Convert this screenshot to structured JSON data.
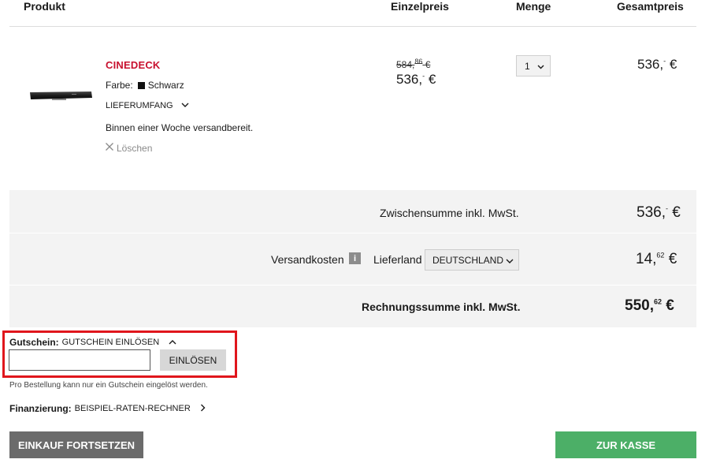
{
  "header": {
    "product": "Produkt",
    "unit_price": "Einzelpreis",
    "quantity": "Menge",
    "total_price": "Gesamtpreis"
  },
  "item": {
    "brand": "CINEDECK",
    "color_label": "Farbe:",
    "color_value": "Schwarz",
    "scope": "LIEFERUMFANG",
    "availability": "Binnen einer Woche versandbereit.",
    "delete": "Löschen",
    "old_price_main": "584,",
    "old_price_sup": "86",
    "old_price_currency": "€",
    "price_main": "536,",
    "price_sup": "-",
    "price_currency": "€",
    "quantity": "1",
    "line_total_main": "536,",
    "line_total_sup": "-",
    "line_total_currency": "€"
  },
  "summary": {
    "subtotal_label": "Zwischensumme inkl. MwSt.",
    "subtotal_main": "536,",
    "subtotal_sup": "-",
    "subtotal_currency": "€",
    "shipping_label": "Versandkosten",
    "info_icon": "i",
    "country_label": "Lieferland",
    "country_value": "DEUTSCHLAND",
    "shipping_main": "14,",
    "shipping_sup": "62",
    "shipping_currency": "€",
    "total_label": "Rechnungssumme inkl. MwSt.",
    "total_main": "550,",
    "total_sup": "62",
    "total_currency": "€"
  },
  "coupon": {
    "label": "Gutschein:",
    "action": "GUTSCHEIN EINLÖSEN",
    "input_value": "",
    "button": "EINLÖSEN",
    "note": "Pro Bestellung kann nur ein Gutschein eingelöst werden."
  },
  "finance": {
    "label": "Finanzierung:",
    "action": "BEISPIEL-RATEN-RECHNER"
  },
  "buttons": {
    "continue": "EINKAUF FORTSETZEN",
    "checkout": "ZUR KASSE"
  },
  "colors": {
    "brand_red": "#c8102e",
    "highlight_red": "#e0161c",
    "checkout_green": "#4caf67",
    "continue_gray": "#6b6b6b"
  },
  "icons": {
    "scope_toggle": "chevron-down-icon",
    "delete": "close-icon",
    "qty_dropdown": "chevron-down-icon",
    "country_dropdown": "chevron-down-icon",
    "coupon_toggle": "chevron-up-icon",
    "finance_link": "chevron-right-icon",
    "shipping_info": "info-icon"
  }
}
